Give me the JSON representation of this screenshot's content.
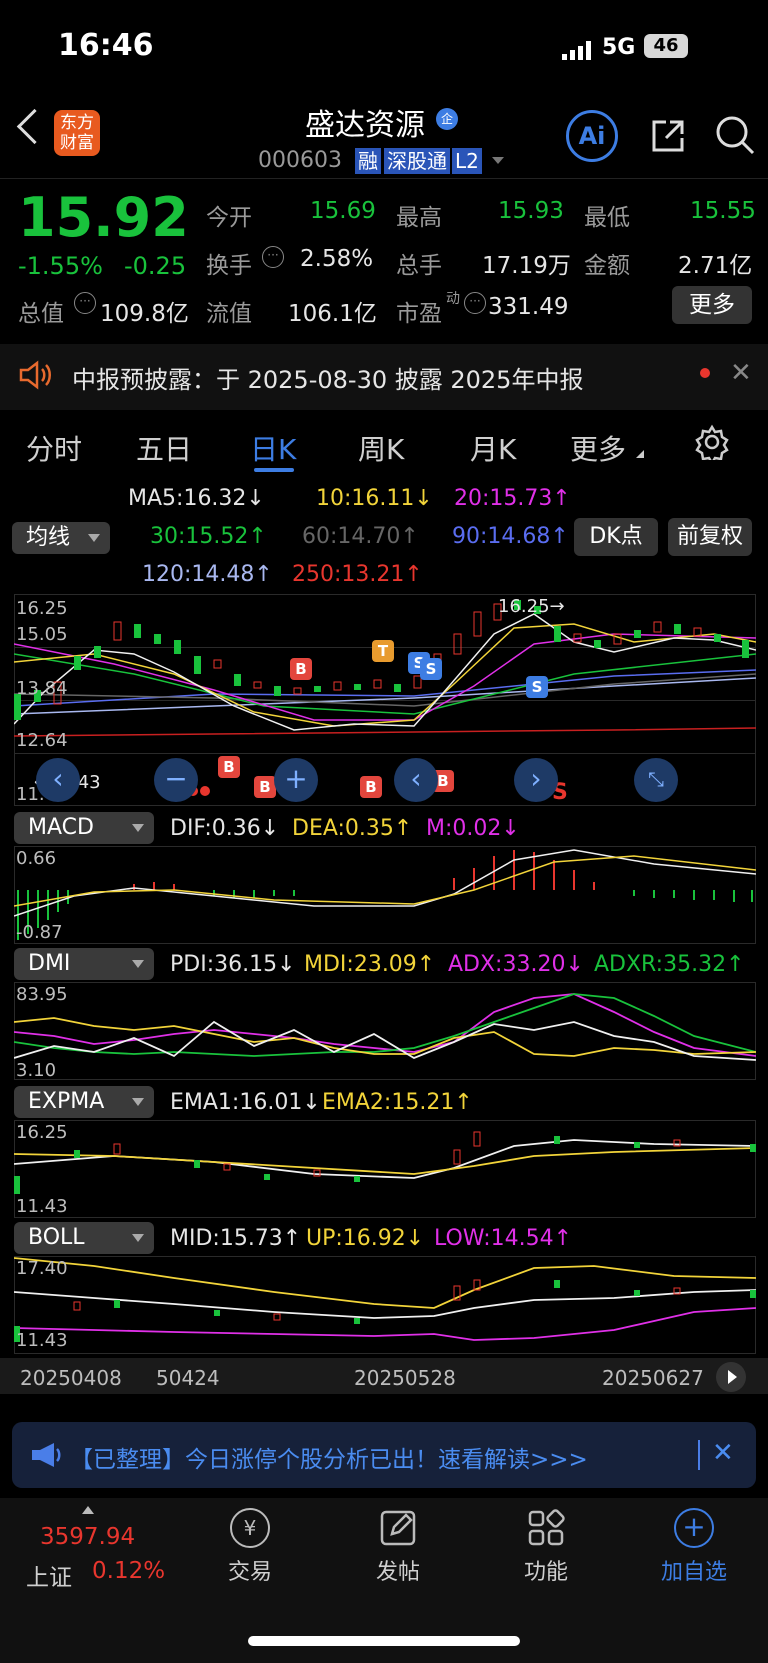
{
  "status_bar": {
    "time": "16:46",
    "network": "5G",
    "battery": "46"
  },
  "header": {
    "logo_line1": "东方",
    "logo_line2": "财富",
    "stock_name": "盛达资源",
    "stock_code": "000603",
    "tags": [
      "融",
      "深股通",
      "L2"
    ],
    "ai_label": "Ai"
  },
  "quote": {
    "price": "15.92",
    "change_pct": "-1.55%",
    "change": "-0.25",
    "open_label": "今开",
    "open": "15.69",
    "high_label": "最高",
    "high": "15.93",
    "low_label": "最低",
    "low": "15.55",
    "turnover_label": "换手",
    "turnover": "2.58%",
    "volume_label": "总手",
    "volume": "17.19万",
    "amount_label": "金额",
    "amount": "2.71亿",
    "mcap_label": "总值",
    "mcap": "109.8亿",
    "float_label": "流值",
    "float": "106.1亿",
    "pe_label": "市盈",
    "pe_sup": "动",
    "pe": "331.49",
    "more_label": "更多"
  },
  "notice": {
    "text": "中报预披露：于 2025-08-30 披露 2025年中报"
  },
  "tabs": [
    "分时",
    "五日",
    "日K",
    "周K",
    "月K",
    "更多"
  ],
  "active_tab": "日K",
  "ma": {
    "selector": "均线",
    "ma5": "MA5:16.32↓",
    "ma10": "10:16.11↓",
    "ma20": "20:15.73↑",
    "ma30": "30:15.52↑",
    "ma60": "60:14.70↑",
    "ma90": "90:14.68↑",
    "ma120": "120:14.48↑",
    "ma250": "250:13.21↑",
    "dk_label": "DK点",
    "fq_label": "前复权"
  },
  "kline": {
    "y_labels": [
      "16.25",
      "15.05",
      "13.84",
      "12.64",
      "11.43"
    ],
    "max_marker": "16.25→",
    "min_marker": "←11.43",
    "sig_b": "B",
    "sig_s": "S",
    "sig_t": "T"
  },
  "macd": {
    "name": "MACD",
    "dif": "DIF:0.36↓",
    "dea": "DEA:0.35↑",
    "m": "M:0.02↓",
    "y_top": "0.66",
    "y_bot": "-0.87"
  },
  "dmi": {
    "name": "DMI",
    "pdi": "PDI:36.15↓",
    "mdi": "MDI:23.09↑",
    "adx": "ADX:33.20↓",
    "adxr": "ADXR:35.32↑",
    "y_top": "83.95",
    "y_bot": "3.10"
  },
  "expma": {
    "name": "EXPMA",
    "ema1": "EMA1:16.01↓",
    "ema2": "EMA2:15.21↑",
    "y_top": "16.25",
    "y_bot": "11.43"
  },
  "boll": {
    "name": "BOLL",
    "mid": "MID:15.73↑",
    "up": "UP:16.92↓",
    "low": "LOW:14.54↑",
    "y_top": "17.40",
    "y_bot": "11.43"
  },
  "dates": [
    "20250408",
    "50424",
    "20250528",
    "20250627"
  ],
  "banner": {
    "text": "【已整理】今日涨停个股分析已出！速看解读>>>"
  },
  "bottom_bar": {
    "index_value": "3597.94",
    "index_name": "上证",
    "index_change": "0.12%",
    "trade": "交易",
    "post": "发帖",
    "func": "功能",
    "add": "加自选"
  },
  "colors": {
    "up": "#e8362e",
    "down": "#19c23c",
    "accent": "#3d7de3"
  }
}
